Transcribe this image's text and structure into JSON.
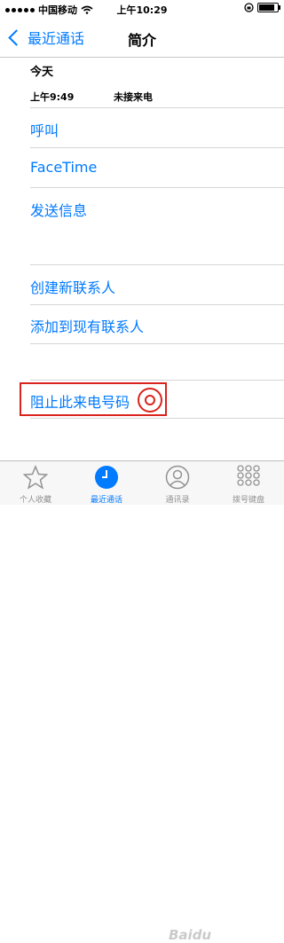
{
  "status_bar": {
    "carrier": "中国移动",
    "time": "上午10:29"
  },
  "nav": {
    "back_label": "最近通话",
    "title": "简介"
  },
  "call_info": {
    "day": "今天",
    "time": "上午9:49",
    "type": "未接来电"
  },
  "actions": {
    "call": "呼叫",
    "facetime": "FaceTime",
    "send_message": "发送信息",
    "create_contact": "创建新联系人",
    "add_to_existing": "添加到现有联系人",
    "block_caller": "阻止此来电号码"
  },
  "tabs": [
    {
      "label": "个人收藏",
      "icon": "star-icon"
    },
    {
      "label": "最近通话",
      "icon": "clock-icon",
      "active": true
    },
    {
      "label": "通讯录",
      "icon": "contacts-icon"
    },
    {
      "label": "拨号键盘",
      "icon": "keypad-icon"
    }
  ],
  "watermark": "Baidu",
  "colors": {
    "accent": "#007aff",
    "highlight": "#d9231d"
  }
}
